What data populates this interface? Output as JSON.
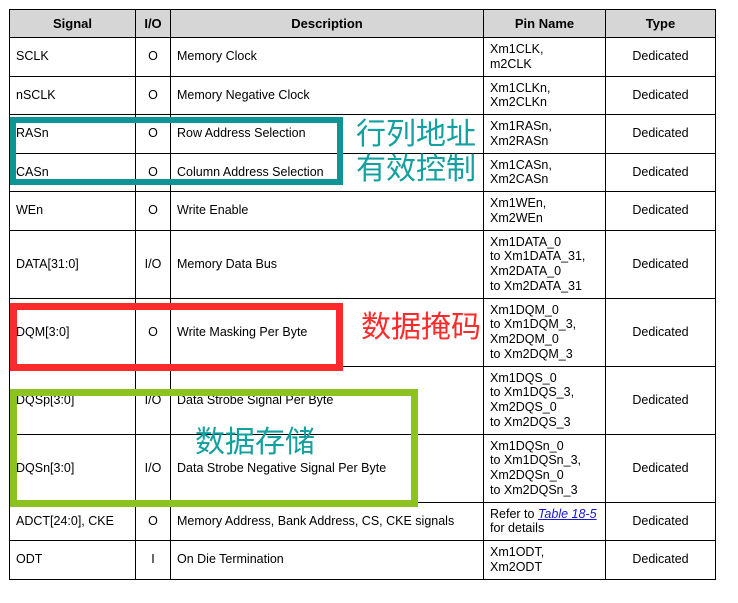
{
  "document": {
    "table_caption": "",
    "columns": [
      "Signal",
      "I/O",
      "Description",
      "Pin Name",
      "Type"
    ]
  },
  "table": {
    "headers": {
      "signal": "Signal",
      "io": "I/O",
      "description": "Description",
      "pin_name": "Pin Name",
      "type": "Type"
    },
    "rows": [
      {
        "signal": "SCLK",
        "io": "O",
        "description": "Memory Clock",
        "pin_name": "Xm1CLK,\nm2CLK",
        "type": "Dedicated"
      },
      {
        "signal": "nSCLK",
        "io": "O",
        "description": "Memory Negative Clock",
        "pin_name": "Xm1CLKn,\nXm2CLKn",
        "type": "Dedicated"
      },
      {
        "signal": "RASn",
        "io": "O",
        "description": "Row Address Selection",
        "pin_name": "Xm1RASn,\nXm2RASn",
        "type": "Dedicated"
      },
      {
        "signal": "CASn",
        "io": "O",
        "description": "Column Address Selection",
        "pin_name": "Xm1CASn,\nXm2CASn",
        "type": "Dedicated"
      },
      {
        "signal": "WEn",
        "io": "O",
        "description": "Write Enable",
        "pin_name": "Xm1WEn,\nXm2WEn",
        "type": "Dedicated"
      },
      {
        "signal": "DATA[31:0]",
        "io": "I/O",
        "description": "Memory Data Bus",
        "pin_name": "Xm1DATA_0\nto Xm1DATA_31,\nXm2DATA_0\nto Xm2DATA_31",
        "type": "Dedicated"
      },
      {
        "signal": "DQM[3:0]",
        "io": "O",
        "description": "Write Masking Per Byte",
        "pin_name": "Xm1DQM_0\nto Xm1DQM_3,\nXm2DQM_0\nto Xm2DQM_3",
        "type": "Dedicated"
      },
      {
        "signal": "DQSp[3:0]",
        "io": "I/O",
        "description": "Data Strobe Signal Per Byte",
        "pin_name": "Xm1DQS_0\nto Xm1DQS_3,\nXm2DQS_0\nto Xm2DQS_3",
        "type": "Dedicated"
      },
      {
        "signal": "DQSn[3:0]",
        "io": "I/O",
        "description": "Data Strobe Negative Signal Per Byte",
        "pin_name": "Xm1DQSn_0\nto Xm1DQSn_3,\nXm2DQSn_0\nto Xm2DQSn_3",
        "type": "Dedicated"
      },
      {
        "signal": "ADCT[24:0], CKE",
        "io": "O",
        "description": "Memory Address, Bank Address, CS, CKE signals",
        "pin_name_prefix": "Refer to ",
        "pin_name_link": "Table 18-5",
        "pin_name_suffix": " for details",
        "type": "Dedicated"
      },
      {
        "signal": "ODT",
        "io": "I",
        "description": "On Die Termination",
        "pin_name": "Xm1ODT,\nXm2ODT",
        "type": "Dedicated"
      }
    ]
  },
  "annotations": {
    "teal_group": {
      "line1": "行列地址",
      "line2": "有效控制",
      "color": "#12a0a0",
      "box_color": "#0e9494"
    },
    "red_group": {
      "label": "数据掩码",
      "color": "#fb2b2b",
      "box_color": "#fb2b2b"
    },
    "green_group": {
      "label": "数据存储",
      "color": "#12a0a0",
      "box_color": "#8ec220"
    }
  }
}
